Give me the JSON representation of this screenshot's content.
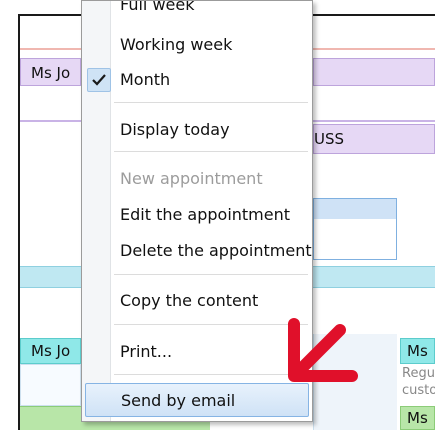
{
  "calendar": {
    "event_ms_jo_top": "Ms Jo",
    "event_uss": "USS",
    "event_ms_jo_bottom": "Ms Jo",
    "event_ms_right": "Ms",
    "event_regu": "Regu",
    "event_custo": "custo",
    "event_ms_bottom_right": "Ms"
  },
  "menu": {
    "items": [
      {
        "label": "Full week",
        "enabled": true
      },
      {
        "label": "Working week",
        "enabled": true
      },
      {
        "label": "Month",
        "enabled": true,
        "checked": true
      },
      {
        "label": "Display today",
        "enabled": true
      },
      {
        "label": "New appointment",
        "enabled": false
      },
      {
        "label": "Edit the appointment",
        "enabled": true
      },
      {
        "label": "Delete the appointment",
        "enabled": true
      },
      {
        "label": "Copy the content",
        "enabled": true
      },
      {
        "label": "Print...",
        "enabled": true
      },
      {
        "label": "Send by email",
        "enabled": true,
        "highlighted": true
      }
    ]
  },
  "colors": {
    "highlight": "#cfe2f6",
    "arrow": "#e0102a",
    "lavender": "#e6d8f5",
    "cyan": "#8fe0e8",
    "green": "#b8e6a8"
  }
}
